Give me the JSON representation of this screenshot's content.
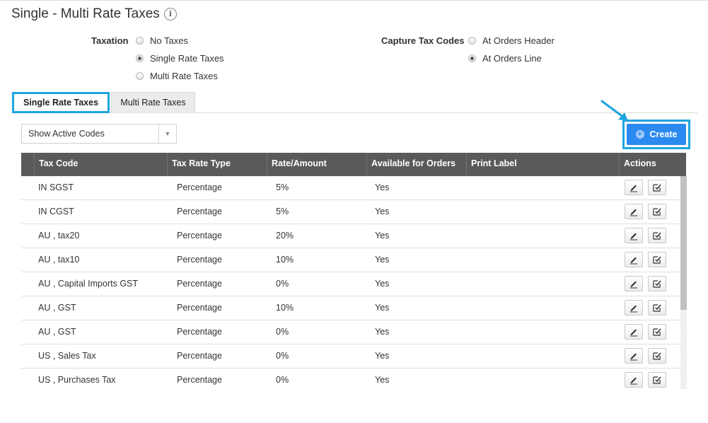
{
  "page": {
    "title": "Single - Multi Rate Taxes"
  },
  "taxation": {
    "label": "Taxation",
    "options": [
      {
        "label": "No Taxes",
        "checked": false
      },
      {
        "label": "Single Rate Taxes",
        "checked": true
      },
      {
        "label": "Multi Rate Taxes",
        "checked": false
      }
    ]
  },
  "capture": {
    "label": "Capture Tax Codes",
    "options": [
      {
        "label": "At Orders Header",
        "checked": false
      },
      {
        "label": "At Orders Line",
        "checked": true
      }
    ]
  },
  "tabs": [
    {
      "label": "Single Rate Taxes",
      "active": true
    },
    {
      "label": "Multi Rate Taxes",
      "active": false
    }
  ],
  "filter": {
    "selected": "Show Active Codes"
  },
  "toolbar": {
    "create_label": "Create"
  },
  "table": {
    "headers": [
      "Tax Code",
      "Tax Rate Type",
      "Rate/Amount",
      "Available for Orders",
      "Print Label",
      "Actions"
    ],
    "rows": [
      [
        "IN SGST",
        "Percentage",
        "5%",
        "Yes",
        ""
      ],
      [
        "IN CGST",
        "Percentage",
        "5%",
        "Yes",
        ""
      ],
      [
        "AU , tax20",
        "Percentage",
        "20%",
        "Yes",
        ""
      ],
      [
        "AU , tax10",
        "Percentage",
        "10%",
        "Yes",
        ""
      ],
      [
        "AU , Capital Imports GST",
        "Percentage",
        "0%",
        "Yes",
        ""
      ],
      [
        "AU , GST",
        "Percentage",
        "10%",
        "Yes",
        ""
      ],
      [
        "AU , GST",
        "Percentage",
        "0%",
        "Yes",
        ""
      ],
      [
        "US , Sales Tax",
        "Percentage",
        "0%",
        "Yes",
        ""
      ],
      [
        "US , Purchases Tax",
        "Percentage",
        "0%",
        "Yes",
        ""
      ]
    ]
  },
  "colors": {
    "accent": "#2b8af0",
    "highlight": "#1ea5e0",
    "header_bg": "#5a5a5a"
  }
}
